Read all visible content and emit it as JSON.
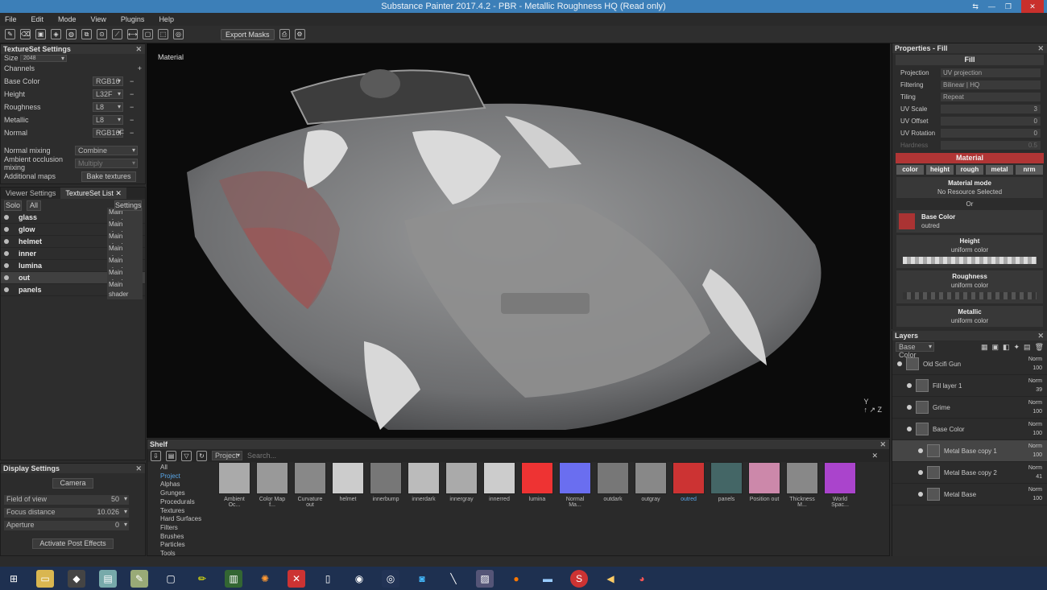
{
  "window": {
    "title": "Substance Painter 2017.4.2 - PBR - Metallic Roughness HQ (Read only)"
  },
  "menu": [
    "File",
    "Edit",
    "Mode",
    "View",
    "Plugins",
    "Help"
  ],
  "toolbar": {
    "export_masks": "Export Masks"
  },
  "textureset_settings": {
    "title": "TextureSet Settings",
    "size_label": "Size",
    "size_value": "2048",
    "channels_label": "Channels",
    "channels": [
      {
        "name": "Base Color",
        "format": "RGB16"
      },
      {
        "name": "Height",
        "format": "L32F"
      },
      {
        "name": "Roughness",
        "format": "L8"
      },
      {
        "name": "Metallic",
        "format": "L8"
      },
      {
        "name": "Normal",
        "format": "RGB16F"
      }
    ],
    "normal_mixing_label": "Normal mixing",
    "normal_mixing_value": "Combine",
    "ao_mixing_label": "Ambient occlusion mixing",
    "ao_mixing_value": "Multiply",
    "additional_maps_label": "Additional maps",
    "bake_button": "Bake textures"
  },
  "tslist": {
    "tabs": [
      "Viewer Settings",
      "TextureSet List"
    ],
    "solo": "Solo",
    "all": "All",
    "settings": "Settings",
    "items": [
      {
        "name": "glass",
        "shader": "Main shader"
      },
      {
        "name": "glow",
        "shader": "Main shader"
      },
      {
        "name": "helmet",
        "shader": "Main shader"
      },
      {
        "name": "inner",
        "shader": "Main shader"
      },
      {
        "name": "lumina",
        "shader": "Main shader"
      },
      {
        "name": "out",
        "shader": "Main shader"
      },
      {
        "name": "panels",
        "shader": "Main shader"
      }
    ]
  },
  "display": {
    "title": "Display Settings",
    "camera": "Camera",
    "fov_label": "Field of view",
    "fov_value": "50",
    "focus_label": "Focus distance",
    "focus_value": "10.026",
    "aperture_label": "Aperture",
    "aperture_value": "0",
    "post_effects": "Activate Post Effects"
  },
  "viewport": {
    "label": "Material"
  },
  "shelf": {
    "title": "Shelf",
    "filter": "Project",
    "search_placeholder": "Search...",
    "categories": [
      "All",
      "Project",
      "Alphas",
      "Grunges",
      "Procedurals",
      "Textures",
      "Hard Surfaces",
      "Filters",
      "Brushes",
      "Particles",
      "Tools"
    ],
    "items": [
      "Ambient Oc...",
      "Color Map f...",
      "Curvature out",
      "helmet",
      "innerbump",
      "innerdark",
      "innergray",
      "innerred",
      "lumina",
      "Normal Ma...",
      "outdark",
      "outgray",
      "outred",
      "panels",
      "Position out",
      "Thickness M...",
      "World Spac..."
    ]
  },
  "props": {
    "title": "Properties - Fill",
    "fill": "Fill",
    "projection_label": "Projection",
    "projection_value": "UV projection",
    "filtering_label": "Filtering",
    "filtering_value": "Bilinear | HQ",
    "tiling_label": "Tiling",
    "tiling_value": "Repeat",
    "uvscale_label": "UV Scale",
    "uvscale_value": "3",
    "uvoffset_label": "UV Offset",
    "uvoffset_value": "0",
    "uvrotation_label": "UV Rotation",
    "uvrotation_value": "0",
    "hardness_label": "Hardness",
    "hardness_value": "0.5",
    "material": "Material",
    "chan": [
      "color",
      "height",
      "rough",
      "metal",
      "nrm"
    ],
    "material_mode": "Material mode",
    "no_resource": "No Resource Selected",
    "or": "Or",
    "basecolor": "Base Color",
    "basecolor_val": "outred",
    "height": "Height",
    "roughness": "Roughness",
    "metallic": "Metallic",
    "uniform": "uniform color"
  },
  "layers": {
    "title": "Layers",
    "channel": "Base Color",
    "items": [
      {
        "name": "Old Scifi Gun",
        "blend": "Norm",
        "opacity": "100"
      },
      {
        "name": "Fill layer 1",
        "blend": "Norm",
        "opacity": "39"
      },
      {
        "name": "Grime",
        "blend": "Norm",
        "opacity": "100"
      },
      {
        "name": "Base Color",
        "blend": "Norm",
        "opacity": "100"
      },
      {
        "name": "Metal Base copy 1",
        "blend": "Norm",
        "opacity": "100"
      },
      {
        "name": "Metal Base copy 2",
        "blend": "Norm",
        "opacity": "41"
      },
      {
        "name": "Metal Base",
        "blend": "Norm",
        "opacity": "100"
      }
    ]
  }
}
